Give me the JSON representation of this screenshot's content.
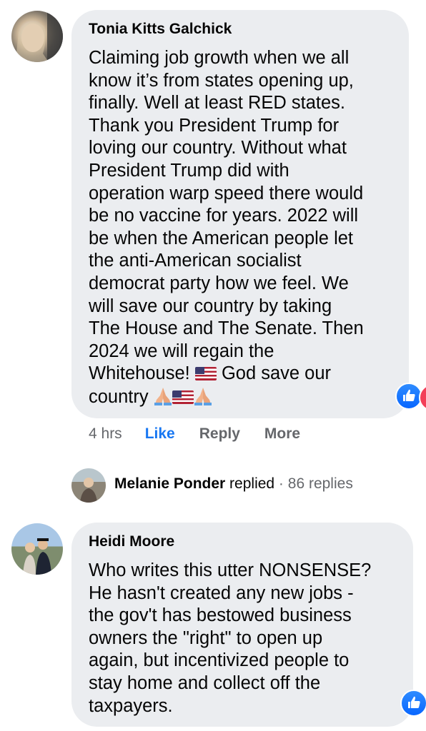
{
  "comments": [
    {
      "author": "Tonia Kitts Galchick",
      "text_main": "Claiming job growth when we all\nknow it’s from states opening up,\nfinally. Well at least RED states.\nThank you President Trump for\nloving our country. Without what\nPresident Trump did with\noperation warp speed there would\nbe no vaccine for years. 2022 will\nbe when the American people let\nthe anti-American socialist\ndemocrat party how we feel. We\nwill save our country by taking\nThe House and The Senate. Then\n2024 we will regain the\nWhitehouse!",
      "text_after_flag": "God save our",
      "text_last": "country",
      "emoji": [
        "flag-us-icon",
        "folded-hands-icon",
        "flag-us-icon",
        "folded-hands-icon"
      ],
      "time": "4 hrs",
      "actions": {
        "like": "Like",
        "reply": "Reply",
        "more": "More"
      },
      "reaction": "like-reaction-icon"
    },
    {
      "author": "Heidi Moore",
      "text_main": "Who writes this utter NONSENSE?\nHe hasn't created any new jobs -\nthe gov't has bestowed business\nowners the \"right\" to open up\nagain, but incentivized people to\nstay home and collect off the\ntaxpayers.",
      "reaction": "like-reaction-icon"
    }
  ],
  "reply_summary": {
    "name": "Melanie Ponder",
    "verb": "replied",
    "separator": " · ",
    "count": "86 replies"
  },
  "colors": {
    "bubble": "#ebedf0",
    "like_blue": "#1877f2",
    "meta_gray": "#65676b",
    "text": "#050505"
  }
}
